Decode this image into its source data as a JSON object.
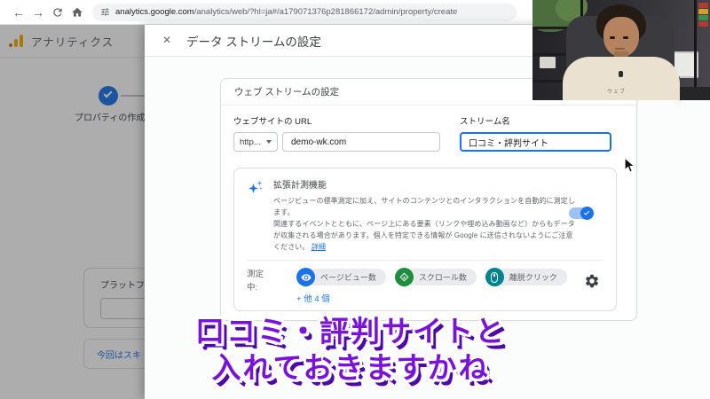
{
  "browser": {
    "back_icon": "←",
    "forward_icon": "→",
    "url_domain": "analytics.google.com",
    "url_path": "/analytics/web/?hl=ja#/a179071376p281866172/admin/property/create"
  },
  "background_page": {
    "app_title": "アナリティクス",
    "step_label": "プロパティの作成",
    "platform_label": "プラットフ",
    "skip_link": "今回はスキ"
  },
  "modal": {
    "close_icon": "×",
    "title": "データ ストリームの設定",
    "card_header": "ウェブ ストリームの設定",
    "website_url_label": "ウェブサイトの URL",
    "protocol_value": "http...",
    "website_url_value": "demo-wk.com",
    "stream_name_label": "ストリーム名",
    "stream_name_value": "口コミ・評判サイト",
    "enhanced": {
      "title": "拡張計測機能",
      "desc1": "ページビューの標準測定に加え、サイトのコンテンツとのインタラクションを自動的に測定します。",
      "desc2": "関連するイベントとともに、ページ上にある要素（リンクや埋め込み動画など）からもデータが収集される場合があります。個人を特定できる情報が Google に送信されないようにご注意ください。",
      "detail_link": "詳細",
      "toggle_state": "on",
      "measuring_label": "測定中:",
      "badges": [
        {
          "label": "ページビュー数",
          "icon": "eye-icon",
          "color": "#1a73e8"
        },
        {
          "label": "スクロール数",
          "icon": "scroll-icon",
          "color": "#1e8e3e"
        },
        {
          "label": "離脱クリック",
          "icon": "mouse-icon",
          "color": "#00838f"
        }
      ],
      "more_link": "+ 他 4 個"
    }
  },
  "webcam": {
    "shirt_text": "ウェブ"
  },
  "caption": {
    "line1": "口コミ・評判サイトと",
    "line2": "入れておきますかね",
    "color": "#7a12d8"
  },
  "colors": {
    "accent_blue": "#1a73e8",
    "toggle_track": "#9ec1f7",
    "badge_green": "#1e8e3e",
    "badge_teal": "#00838f",
    "logo_orange": "#f9ab00",
    "caption_purple": "#7a12d8",
    "scrim": "rgba(32,33,36,0.37)"
  }
}
